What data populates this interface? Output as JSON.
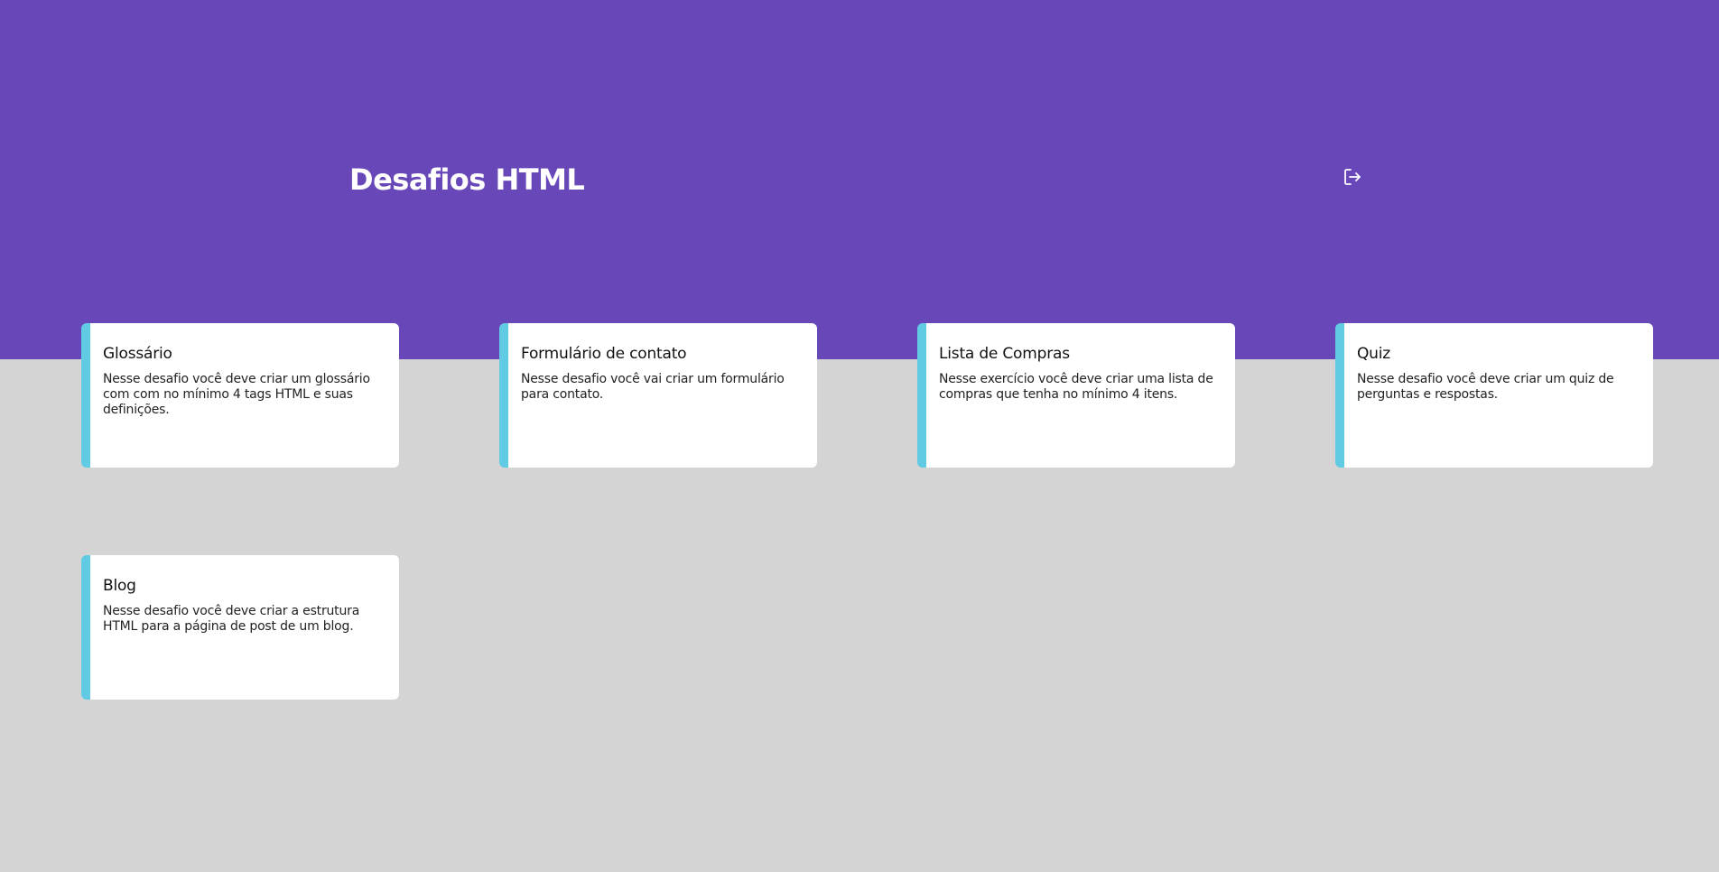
{
  "header": {
    "title": "Desafios HTML",
    "logout_icon": "logout-icon"
  },
  "colors": {
    "header_bg": "#6848b9",
    "page_bg": "#d4d4d4",
    "card_bg": "#ffffff",
    "card_accent": "#62cbe4"
  },
  "cards": [
    {
      "title": "Glossário",
      "description": "Nesse desafio você deve criar um glossário com com no mínimo 4 tags HTML e suas definições."
    },
    {
      "title": "Formulário de contato",
      "description": "Nesse desafio você vai criar um formulário para contato."
    },
    {
      "title": "Lista de Compras",
      "description": "Nesse exercício você deve criar uma lista de compras que tenha no mínimo 4 itens."
    },
    {
      "title": "Quiz",
      "description": "Nesse desafio você deve criar um quiz de perguntas e respostas."
    },
    {
      "title": "Blog",
      "description": "Nesse desafio você deve criar a estrutura HTML para a página de post de um blog."
    }
  ]
}
